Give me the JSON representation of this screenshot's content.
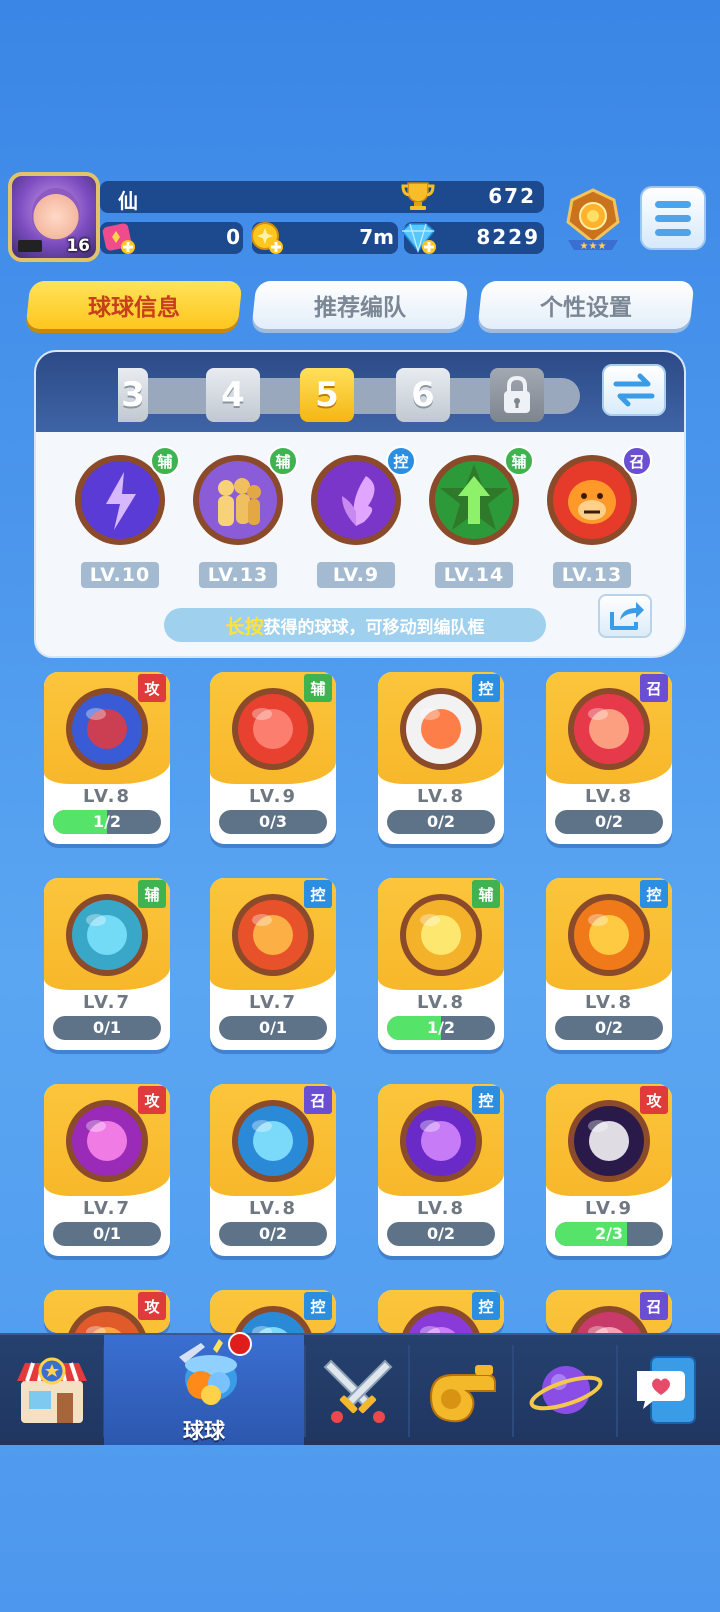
{
  "player": {
    "name": "仙",
    "level": "16",
    "trophies": "672",
    "resource_1": "0",
    "resource_2": "7m",
    "gems": "8229"
  },
  "tabs": [
    {
      "label": "球球信息",
      "active": true
    },
    {
      "label": "推荐编队",
      "active": false
    },
    {
      "label": "个性设置",
      "active": false
    }
  ],
  "team_selector": {
    "numbers": [
      "3",
      "4",
      "5",
      "6"
    ],
    "active": "5"
  },
  "team_balls": [
    {
      "tag": "辅",
      "level": "LV.10",
      "icon": "lightning-ball-icon"
    },
    {
      "tag": "辅",
      "level": "LV.13",
      "icon": "shadow-clone-ball-icon"
    },
    {
      "tag": "控",
      "level": "LV.9",
      "icon": "butterfly-ball-icon"
    },
    {
      "tag": "辅",
      "level": "LV.14",
      "icon": "star-arrow-ball-icon"
    },
    {
      "tag": "召",
      "level": "LV.13",
      "icon": "gorilla-ball-icon"
    }
  ],
  "hint": {
    "key": "长按",
    "text": "获得的球球，可移动到编队框"
  },
  "balls": [
    {
      "tag": "攻",
      "level": "LV.8",
      "progress": "1/2",
      "fraction": 0.5,
      "icon": "opera-mask-ball-icon"
    },
    {
      "tag": "辅",
      "level": "LV.9",
      "progress": "0/3",
      "fraction": 0,
      "icon": "red-envelope-ball-icon"
    },
    {
      "tag": "控",
      "level": "LV.8",
      "progress": "0/2",
      "fraction": 0,
      "icon": "ram-horn-ball-icon"
    },
    {
      "tag": "召",
      "level": "LV.8",
      "progress": "0/2",
      "fraction": 0,
      "icon": "monk-ball-icon"
    },
    {
      "tag": "辅",
      "level": "LV.7",
      "progress": "0/1",
      "fraction": 0,
      "icon": "ghost-ball-icon"
    },
    {
      "tag": "控",
      "level": "LV.7",
      "progress": "0/1",
      "fraction": 0,
      "icon": "star-burst-ball-icon"
    },
    {
      "tag": "辅",
      "level": "LV.8",
      "progress": "1/2",
      "fraction": 0.5,
      "icon": "sun-ball-icon"
    },
    {
      "tag": "控",
      "level": "LV.8",
      "progress": "0/2",
      "fraction": 0,
      "icon": "gem-belt-ball-icon"
    },
    {
      "tag": "攻",
      "level": "LV.7",
      "progress": "0/1",
      "fraction": 0,
      "icon": "scale-ball-icon"
    },
    {
      "tag": "召",
      "level": "LV.8",
      "progress": "0/2",
      "fraction": 0,
      "icon": "potion-ball-icon"
    },
    {
      "tag": "控",
      "level": "LV.8",
      "progress": "0/2",
      "fraction": 0,
      "icon": "spellbook-ball-icon"
    },
    {
      "tag": "攻",
      "level": "LV.9",
      "progress": "2/3",
      "fraction": 0.67,
      "icon": "venom-ball-icon"
    },
    {
      "tag": "攻",
      "icon": "partial-ball-icon"
    },
    {
      "tag": "控",
      "icon": "partial-ball-icon"
    },
    {
      "tag": "控",
      "icon": "partial-ball-icon"
    },
    {
      "tag": "召",
      "icon": "partial-ball-icon"
    }
  ],
  "bottom_nav": [
    {
      "name": "shop",
      "icon": "shop-icon"
    },
    {
      "name": "balls",
      "label": "球球",
      "icon": "ball-cannon-icon",
      "active": true
    },
    {
      "name": "battle",
      "icon": "crossed-swords-icon"
    },
    {
      "name": "whistle",
      "icon": "whistle-icon"
    },
    {
      "name": "planet",
      "icon": "planet-icon"
    },
    {
      "name": "chat",
      "icon": "chat-heart-icon"
    }
  ],
  "colors": {
    "tag_fu": "#3fb350",
    "tag_kong": "#2b8ee0",
    "tag_zhao": "#6a4fd2",
    "tag_gong": "#e03b3b",
    "accent_yellow": "#ffc61e"
  }
}
